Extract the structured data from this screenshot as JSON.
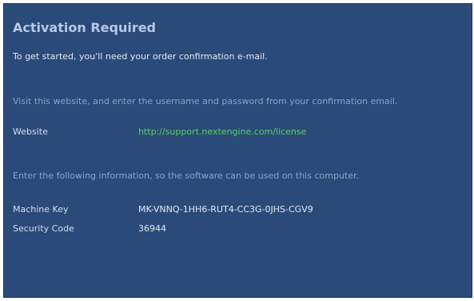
{
  "header": {
    "title": "Activation Required"
  },
  "intro": "To get started, you'll need your order confirmation e-mail.",
  "website_section": {
    "instruction": "Visit this website, and enter the username and password from your confirmation email.",
    "label": "Website",
    "url": "http://support.nextengine.com/license"
  },
  "machine_section": {
    "instruction": "Enter the following information, so the software can be used on this computer.",
    "machine_key_label": "Machine Key",
    "machine_key_value": "MK-VNNQ-1HH6-RUT4-CC3G-0JHS-CGV9",
    "security_code_label": "Security Code",
    "security_code_value": "36944"
  },
  "colors": {
    "panel_background": "#2a4a7a",
    "title": "#b8c8e6",
    "body_text": "#e4e9f3",
    "muted_text": "#8ea3c4",
    "link": "#5cd15a"
  }
}
